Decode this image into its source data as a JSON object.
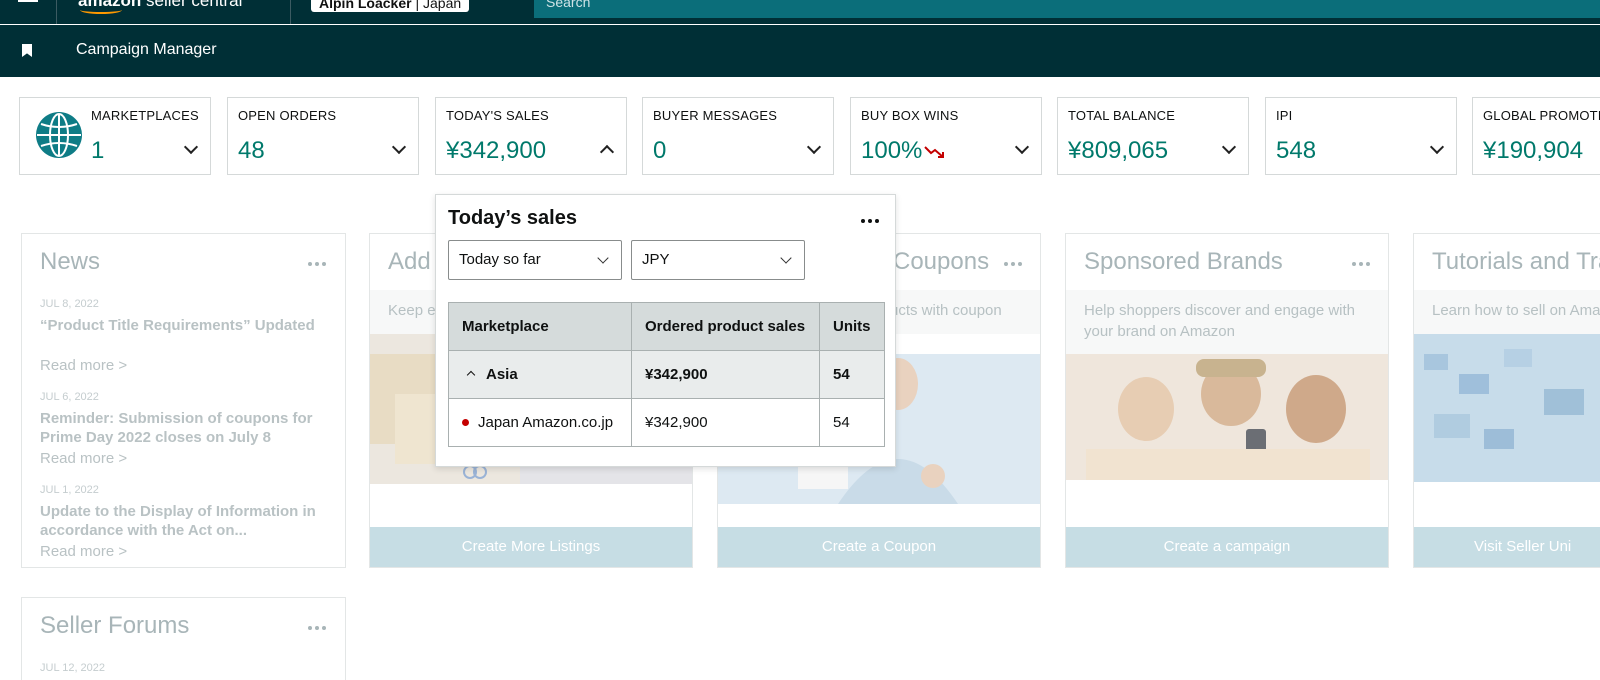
{
  "topbar": {
    "logo_word": "amazon",
    "logo_suffix": "seller central",
    "account_name": "Alpin Loacker",
    "account_region": "| Japan",
    "search_placeholder": "Search"
  },
  "subbar": {
    "title": "Campaign Manager"
  },
  "tiles": [
    {
      "label": "MARKETPLACES",
      "value": "1"
    },
    {
      "label": "OPEN ORDERS",
      "value": "48"
    },
    {
      "label": "TODAY'S SALES",
      "value": "¥342,900"
    },
    {
      "label": "BUYER MESSAGES",
      "value": "0"
    },
    {
      "label": "BUY BOX WINS",
      "value": "100%"
    },
    {
      "label": "TOTAL BALANCE",
      "value": "¥809,065"
    },
    {
      "label": "IPI",
      "value": "548"
    },
    {
      "label": "GLOBAL PROMOTIONS",
      "value": "¥190,904"
    }
  ],
  "news": {
    "title": "News",
    "items": [
      {
        "date": "JUL 8, 2022",
        "headline": "“Product Title Requirements” Updated",
        "more": "Read more >"
      },
      {
        "date": "JUL 6, 2022",
        "headline": "Reminder: Submission of coupons for Prime Day 2022 closes on July 8",
        "more": "Read more >"
      },
      {
        "date": "JUL 1, 2022",
        "headline": "Update to the Display of Information in accordance with the Act on...",
        "more": "Read more >"
      }
    ]
  },
  "cards": {
    "add": {
      "title": "Add",
      "desc": "Keep ex",
      "button": "Create More Listings"
    },
    "coupons": {
      "title": "Coupons",
      "desc": "ucts with coupon",
      "button": "Create a Coupon"
    },
    "sponsored": {
      "title": "Sponsored Brands",
      "desc": "Help shoppers discover and engage with your brand on Amazon",
      "button": "Create a campaign"
    },
    "tutorials": {
      "title": "Tutorials and Tra",
      "desc": "Learn how to sell on Ama",
      "button": "Visit Seller Uni"
    }
  },
  "forums": {
    "title": "Seller Forums",
    "date": "JUL 12, 2022"
  },
  "popover": {
    "title": "Today’s sales",
    "period_select": "Today so far",
    "currency_select": "JPY",
    "columns": [
      "Marketplace",
      "Ordered product sales",
      "Units"
    ],
    "group_row": {
      "name": "Asia",
      "sales": "¥342,900",
      "units": "54"
    },
    "rows": [
      {
        "name": "Japan Amazon.co.jp",
        "sales": "¥342,900",
        "units": "54"
      }
    ]
  },
  "colors": {
    "nav": "#002f36",
    "accent": "#00796b",
    "button_muted": "#c6dde4"
  }
}
